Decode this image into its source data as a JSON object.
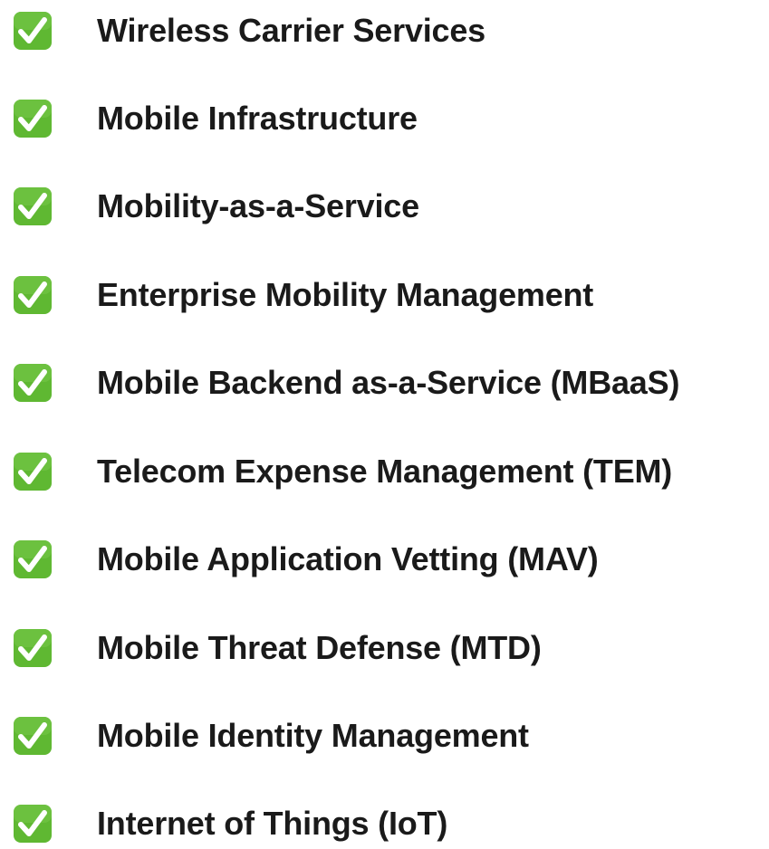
{
  "checklist": {
    "icon": "check-mark-button-icon",
    "icon_color": "#5fb832",
    "items": [
      {
        "label": "Wireless Carrier Services"
      },
      {
        "label": "Mobile Infrastructure"
      },
      {
        "label": "Mobility-as-a-Service"
      },
      {
        "label": "Enterprise Mobility Management"
      },
      {
        "label": "Mobile Backend as-a-Service (MBaaS)"
      },
      {
        "label": "Telecom Expense Management (TEM)"
      },
      {
        "label": "Mobile Application Vetting (MAV)"
      },
      {
        "label": "Mobile Threat Defense (MTD)"
      },
      {
        "label": "Mobile Identity Management"
      },
      {
        "label": "Internet of Things (IoT)"
      }
    ]
  }
}
